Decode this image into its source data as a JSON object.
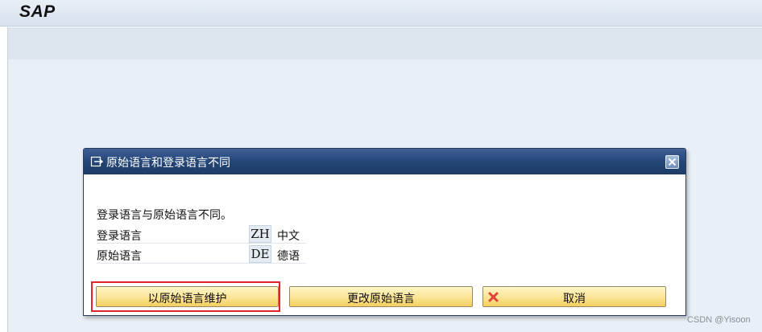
{
  "app": {
    "logo_text": "SAP"
  },
  "dialog": {
    "title": "原始语言和登录语言不同",
    "message": "登录语言与原始语言不同。",
    "rows": [
      {
        "label": "登录语言",
        "code": "ZH",
        "description": "中文"
      },
      {
        "label": "原始语言",
        "code": "DE",
        "description": "德语"
      }
    ],
    "buttons": {
      "maintain": "以原始语言维护",
      "change": "更改原始语言",
      "cancel": "取消"
    }
  },
  "icons": {
    "dialog_title_icon": "window-arrow-icon",
    "close_icon": "close-icon",
    "cancel_icon": "red-x-icon"
  },
  "colors": {
    "dialog_header": "#234474",
    "button_fill": "#fbe28f",
    "highlight": "#e0262b",
    "cancel_icon": "#e2443a"
  },
  "watermark": "CSDN @Yisoon"
}
